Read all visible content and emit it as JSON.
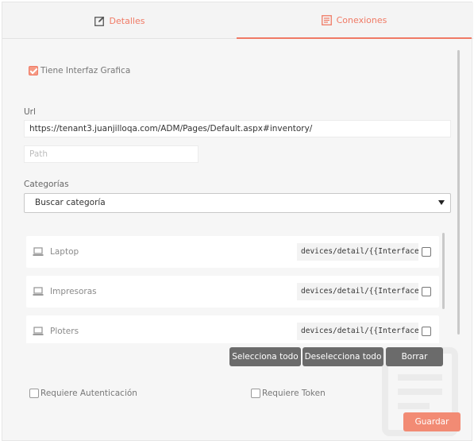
{
  "tabs": [
    {
      "label": "Detalles",
      "icon": "edit-icon"
    },
    {
      "label": "Conexiones",
      "icon": "document-icon"
    }
  ],
  "has_gui": {
    "label": "Tiene Interfaz Grafica",
    "checked": true
  },
  "url": {
    "label": "Url",
    "value": "https://tenant3.juanjilloqa.com/ADM/Pages/Default.aspx#inventory/"
  },
  "path": {
    "placeholder": "Path"
  },
  "categories": {
    "label": "Categorías",
    "selected": "Buscar categoría"
  },
  "devices": [
    {
      "name": "Laptop",
      "route": "devices/detail/{{InterfaceId}}",
      "checked": false
    },
    {
      "name": "Impresoras",
      "route": "devices/detail/{{InterfaceId}}",
      "checked": false
    },
    {
      "name": "Ploters",
      "route": "devices/detail/{{InterfaceId}}",
      "checked": false
    }
  ],
  "actions": {
    "select_all": "Selecciona todo",
    "deselect_all": "Deselecciona todo",
    "delete": "Borrar"
  },
  "requires_auth": {
    "label": "Requiere Autenticación",
    "checked": false
  },
  "requires_token": {
    "label": "Requiere Token",
    "checked": false
  },
  "save": "Guardar",
  "colors": {
    "accent": "#f07a65",
    "button_dark": "#6b6b6b",
    "save_button": "#f28b74"
  }
}
